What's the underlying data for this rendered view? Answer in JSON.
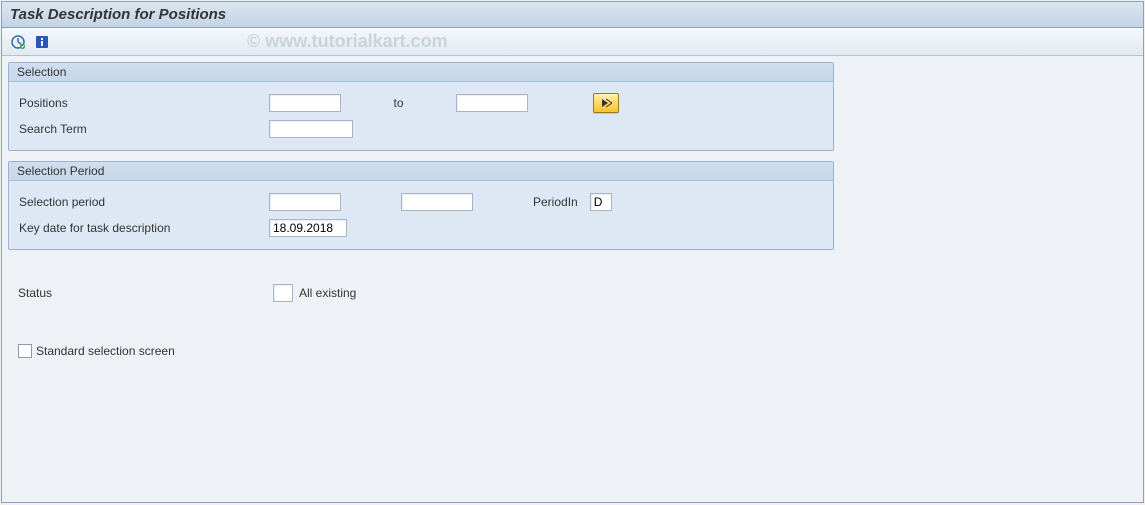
{
  "title": "Task Description for Positions",
  "watermark": "© www.tutorialkart.com",
  "group_selection": {
    "title": "Selection",
    "positions_label": "Positions",
    "positions_from": "",
    "to_label": "to",
    "positions_to": "",
    "search_term_label": "Search Term",
    "search_term_value": ""
  },
  "group_period": {
    "title": "Selection Period",
    "selection_period_label": "Selection period",
    "selection_period_from": "",
    "selection_period_to": "",
    "period_in_label": "PeriodIn",
    "period_in_value": "D",
    "key_date_label": "Key date for task description",
    "key_date_value": "18.09.2018"
  },
  "status": {
    "label": "Status",
    "value": "",
    "text": "All existing"
  },
  "std_selection": {
    "label": "Standard selection screen",
    "checked": false
  }
}
